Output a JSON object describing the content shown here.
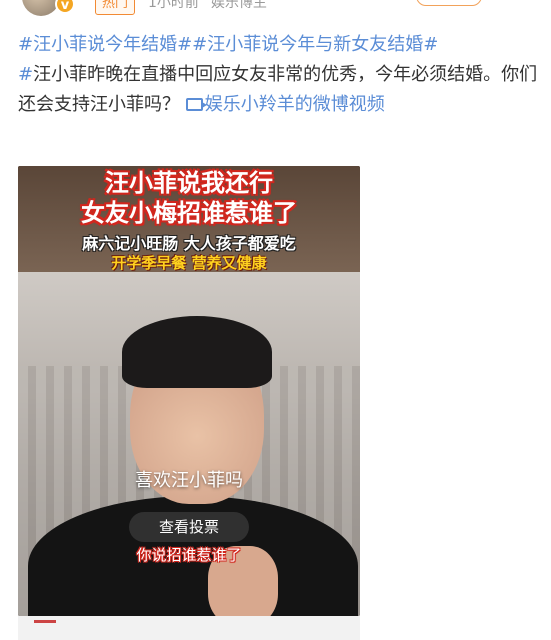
{
  "header": {
    "hot_badge": "热门",
    "time": "1小时前",
    "author_role": "娱乐博主",
    "verified_icon": "verified-badge-icon"
  },
  "post": {
    "hashtag1": "#汪小菲说今年结婚#",
    "hashtag2": "#汪小菲说今年与新女友结婚#",
    "body": "汪小菲昨晚在直播中回应女友非常的优秀，今年必须结婚。你们还会支持汪小菲吗？",
    "video_link": "娱乐小羚羊的微博视频"
  },
  "video": {
    "title_line1": "汪小菲说我还行",
    "title_line2": "女友小梅招谁惹谁了",
    "ad_line1": "麻六记小旺肠 大人孩子都爱吃",
    "ad_line2": "开学季早餐   营养又健康",
    "poll_question": "喜欢汪小菲吗",
    "poll_button": "查看投票",
    "caption": "你说招谁惹谁了"
  },
  "colors": {
    "link": "#5b8dd6",
    "hot": "#f28a33",
    "title_stroke": "#d2281f",
    "ad_yellow": "#ffd21f"
  }
}
